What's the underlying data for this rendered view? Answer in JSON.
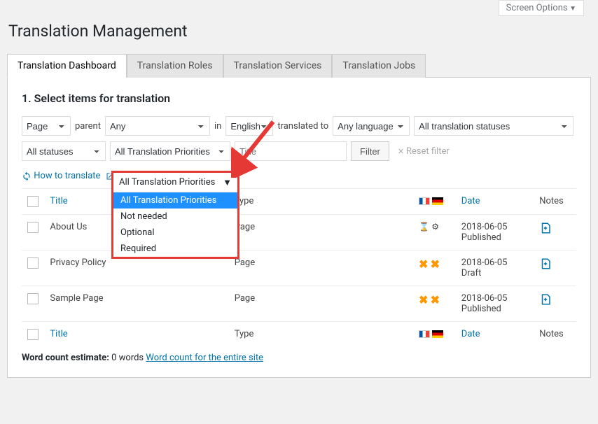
{
  "screen_options": "Screen Options",
  "page_title": "Translation Management",
  "tabs": [
    "Translation Dashboard",
    "Translation Roles",
    "Translation Services",
    "Translation Jobs"
  ],
  "section_title": "1. Select items for translation",
  "filters": {
    "page": "Page",
    "parent_label": "parent",
    "parent": "Any",
    "in_label": "in",
    "lang": "English",
    "translated_to_label": "translated to",
    "tolang": "Any language",
    "status": "All translation statuses",
    "allstat": "All statuses",
    "prio": "All Translation Priorities",
    "title_placeholder": "Title",
    "filter_btn": "Filter",
    "reset": "Reset filter"
  },
  "howto": {
    "text": "How to translate",
    "icon": "↻"
  },
  "dropdown": {
    "label": "All Translation Priorities",
    "options": [
      "All Translation Priorities",
      "Not needed",
      "Optional",
      "Required"
    ]
  },
  "columns": {
    "title": "Title",
    "type": "Type",
    "date": "Date",
    "notes": "Notes"
  },
  "rows": [
    {
      "title": "About Us",
      "type": "Page",
      "status": "progress",
      "date": "2018-06-05",
      "state": "Published"
    },
    {
      "title": "Privacy Policy",
      "type": "Page",
      "status": "xx",
      "date": "2018-06-05",
      "state": "Draft"
    },
    {
      "title": "Sample Page",
      "type": "Page",
      "status": "xx",
      "date": "2018-06-05",
      "state": "Published"
    }
  ],
  "footer": {
    "label": "Word count estimate:",
    "value": "0 words",
    "link": "Word count for the entire site"
  }
}
